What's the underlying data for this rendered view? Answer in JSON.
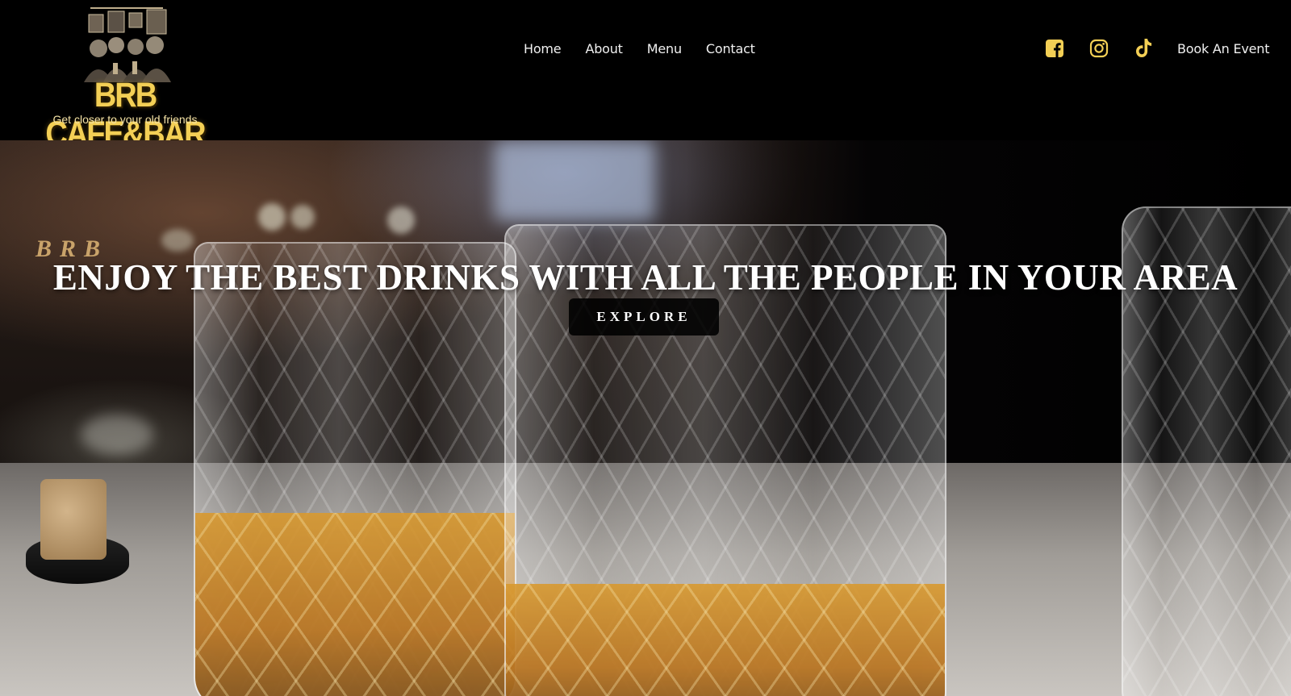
{
  "header": {
    "logo": {
      "name": "BRB CAFE&BAR",
      "tagline": "Get closer to your old friends"
    },
    "nav": [
      {
        "label": "Home"
      },
      {
        "label": "About"
      },
      {
        "label": "Menu"
      },
      {
        "label": "Contact"
      }
    ],
    "socials": [
      {
        "icon": "facebook-icon"
      },
      {
        "icon": "instagram-icon"
      },
      {
        "icon": "tiktok-icon"
      }
    ],
    "book_label": "Book An Event",
    "accent_color": "#f3cf55"
  },
  "hero": {
    "brand": "BRB",
    "title": "ENJOY THE BEST DRINKS WITH ALL THE PEOPLE IN YOUR AREA",
    "cta_label": "EXPLORE"
  }
}
